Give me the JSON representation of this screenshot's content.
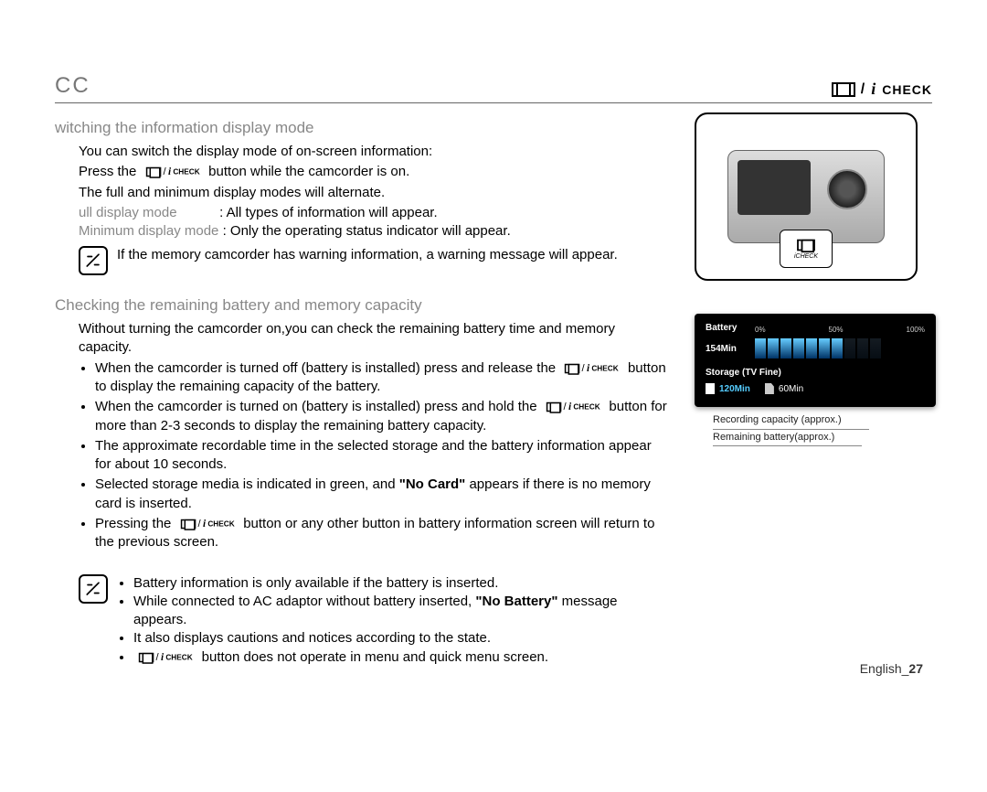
{
  "header": {
    "cc": "CC",
    "check": "CHECK"
  },
  "section1": {
    "heading": "witching the information display mode",
    "p1": "You can switch the display mode of on-screen information:",
    "p2a": "Press the ",
    "p2b": " button while the camcorder is on.",
    "p3": "The full and minimum display modes will alternate.",
    "full_label": "ull display mode",
    "full_text": ": All types of information will appear.",
    "min_label": "Minimum display mode",
    "min_text": ": Only the operating status indicator will appear.",
    "note": "If the memory camcorder has warning information, a warning message will appear."
  },
  "section2": {
    "heading": "Checking the remaining battery and memory capacity",
    "p1": "Without turning the camcorder on,you can check the remaining battery time and memory capacity.",
    "b1a": "When the camcorder is turned off (battery is installed) press and release the ",
    "b1b": " button to display the remaining capacity of the battery.",
    "b2a": "When the camcorder is turned on (battery is installed) press and hold the ",
    "b2b": " button for more than 2-3 seconds to display the remaining battery capacity.",
    "b3": "The approximate recordable time in the selected storage and the battery information appear for about 10 seconds.",
    "b4a": "Selected storage media is indicated in green, and ",
    "b4_bold": "\"No Card\"",
    "b4b": " appears if there is no memory card is inserted.",
    "b5a": "Pressing the ",
    "b5b": " button or any other button in battery information screen will return to the previous screen."
  },
  "notes2": {
    "n1": "Battery information is only available if the battery is inserted.",
    "n2a": "While connected to AC adaptor without battery inserted, ",
    "n2_bold": "\"No Battery\"",
    "n2b": " message appears.",
    "n3": "It also displays cautions and notices according to the state.",
    "n4b": " button does not operate in menu and quick menu screen."
  },
  "icheck_small": "iCHECK",
  "lcd": {
    "battery_label": "Battery",
    "scale0": "0%",
    "scale50": "50%",
    "scale100": "100%",
    "battery_min": "154Min",
    "storage_label": "Storage (TV Fine)",
    "internal": "120Min",
    "card": "60Min"
  },
  "callout1": "Recording capacity (approx.)",
  "callout2": "Remaining battery(approx.)",
  "footer": {
    "lang": "English",
    "sep": "_",
    "page": "27"
  }
}
